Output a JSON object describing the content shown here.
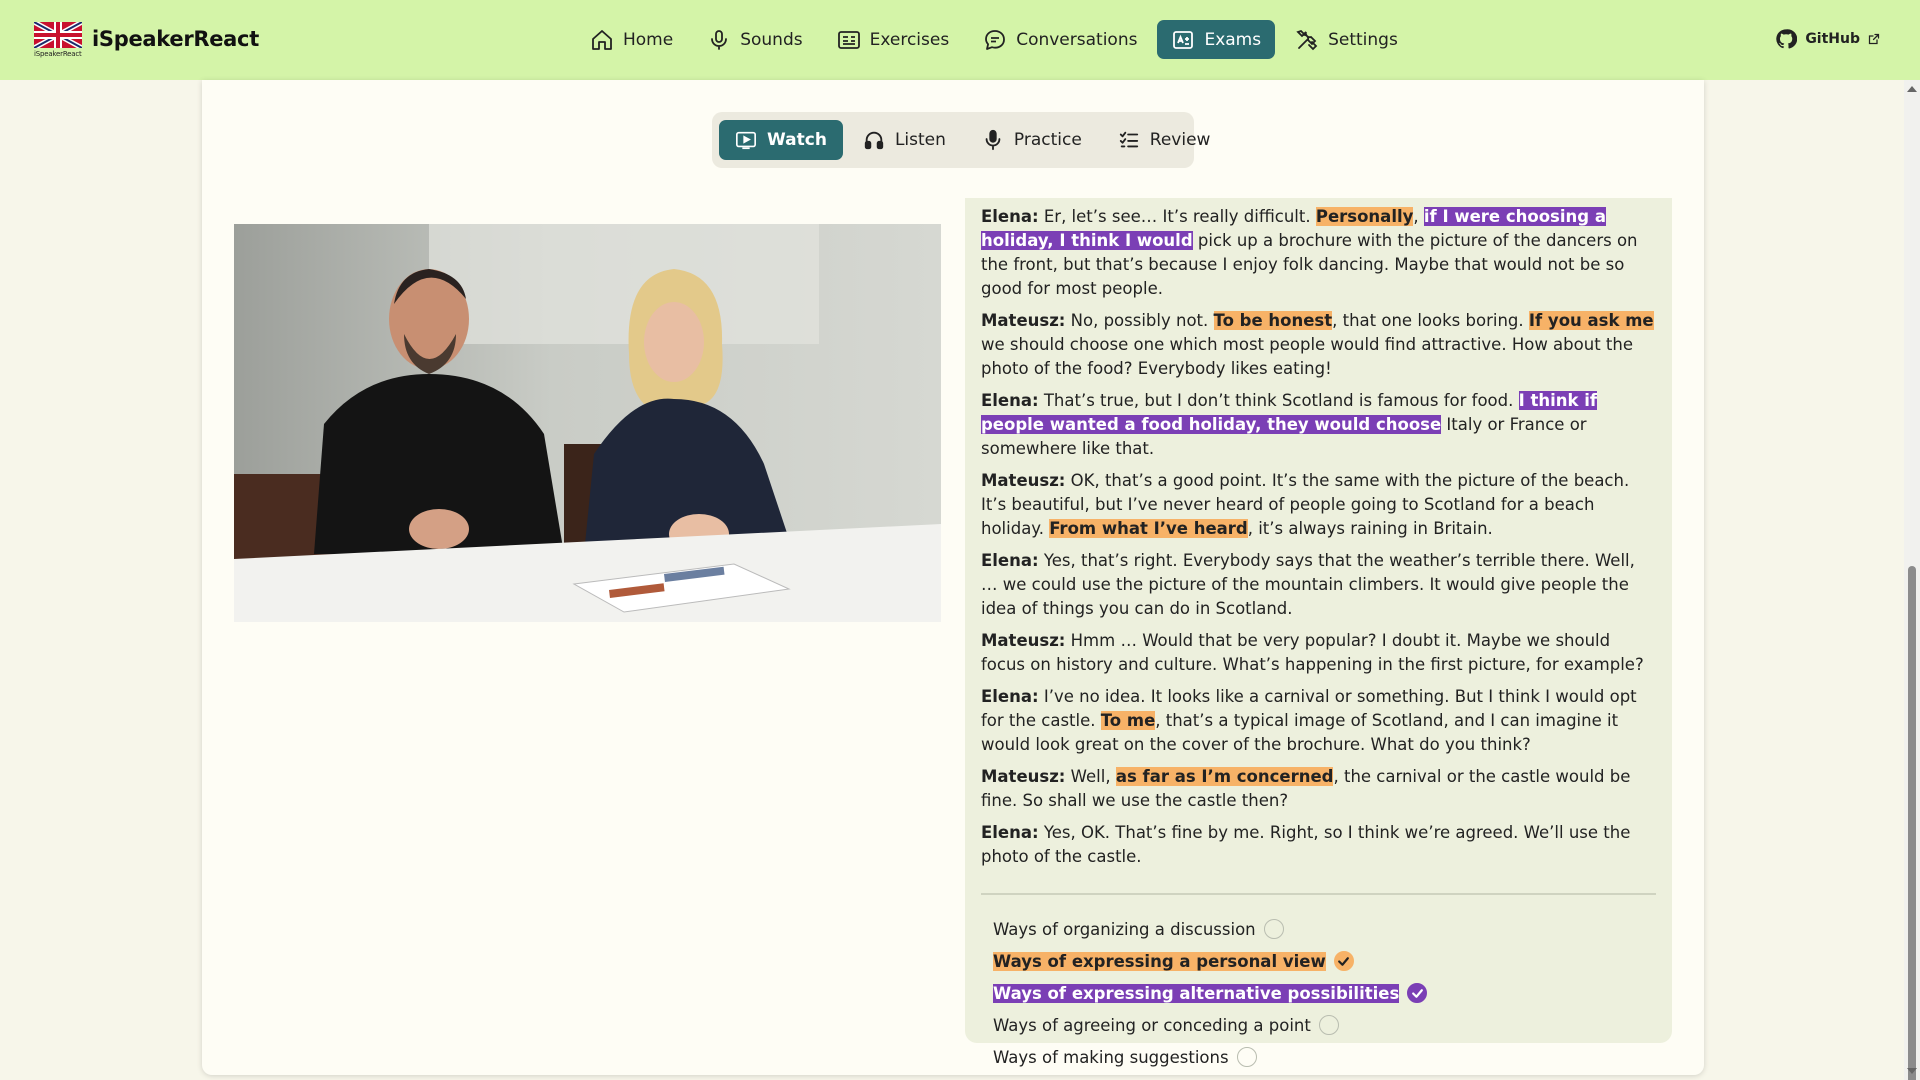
{
  "brand": {
    "name": "iSpeakerReact",
    "logo_text": "iSpeakerReact"
  },
  "nav": {
    "items": [
      {
        "label": "Home",
        "icon": "home-icon"
      },
      {
        "label": "Sounds",
        "icon": "microphone-icon"
      },
      {
        "label": "Exercises",
        "icon": "exercises-icon"
      },
      {
        "label": "Conversations",
        "icon": "chat-bubble-icon"
      },
      {
        "label": "Exams",
        "icon": "exam-icon",
        "active": true
      },
      {
        "label": "Settings",
        "icon": "settings-icon"
      }
    ],
    "github_label": "GitHub"
  },
  "subtabs": [
    {
      "label": "Watch",
      "icon": "video-icon",
      "active": true
    },
    {
      "label": "Listen",
      "icon": "headphones-icon"
    },
    {
      "label": "Practice",
      "icon": "microphone-icon"
    },
    {
      "label": "Review",
      "icon": "checklist-icon"
    }
  ],
  "transcript": [
    {
      "speaker": "Elena:",
      "parts": [
        {
          "t": " Er, let’s see… It’s really difficult. "
        },
        {
          "t": "Personally",
          "h": "o"
        },
        {
          "t": ", "
        },
        {
          "t": "if I were choosing a holiday, I think I would",
          "h": "p"
        },
        {
          "t": " pick up a brochure with the picture of the dancers on the front, but that’s because I enjoy folk dancing. Maybe that would not be so good for most people."
        }
      ]
    },
    {
      "speaker": "Mateusz:",
      "parts": [
        {
          "t": " No, possibly not. "
        },
        {
          "t": "To be honest",
          "h": "o"
        },
        {
          "t": ", that one looks boring. "
        },
        {
          "t": "If you ask me",
          "h": "o"
        },
        {
          "t": " we should choose one which most people would find attractive. How about the photo of the food? Everybody likes eating!"
        }
      ]
    },
    {
      "speaker": "Elena:",
      "parts": [
        {
          "t": " That’s true, but I don’t think Scotland is famous for food. "
        },
        {
          "t": "I think if people wanted a food holiday, they would choose",
          "h": "p"
        },
        {
          "t": " Italy or France or somewhere like that."
        }
      ]
    },
    {
      "speaker": "Mateusz:",
      "parts": [
        {
          "t": " OK, that’s a good point. It’s the same with the picture of the beach. It’s beautiful, but I’ve never heard of people going to Scotland for a beach holiday. "
        },
        {
          "t": "From what I’ve heard",
          "h": "o"
        },
        {
          "t": ", it’s always raining in Britain."
        }
      ]
    },
    {
      "speaker": "Elena:",
      "parts": [
        {
          "t": " Yes, that’s right. Everybody says that the weather’s terrible there. Well, … we could use the picture of the mountain climbers. It would give people the idea of things you can do in Scotland."
        }
      ]
    },
    {
      "speaker": "Mateusz:",
      "parts": [
        {
          "t": " Hmm … Would that be very popular? I doubt it. Maybe we should focus on history and culture. What’s happening in the first picture, for example?"
        }
      ]
    },
    {
      "speaker": "Elena:",
      "parts": [
        {
          "t": " I’ve no idea. It looks like a carnival or something. But I think I would opt for the castle. "
        },
        {
          "t": "To me",
          "h": "o"
        },
        {
          "t": ", that’s a typical image of Scotland, and I can imagine it would look great on the cover of the brochure. What do you think?"
        }
      ]
    },
    {
      "speaker": "Mateusz:",
      "parts": [
        {
          "t": " Well, "
        },
        {
          "t": "as far as I’m concerned",
          "h": "o"
        },
        {
          "t": ", the carnival or the castle would be fine. So shall we use the castle then?"
        }
      ]
    },
    {
      "speaker": "Elena:",
      "parts": [
        {
          "t": " Yes, OK. That’s fine by me. Right, so I think we’re agreed. We’ll use the photo of the castle."
        }
      ]
    }
  ],
  "legend": [
    {
      "label": "Ways of organizing a discussion",
      "checked": false
    },
    {
      "label": "Ways of expressing a personal view",
      "checked": true,
      "h": "o"
    },
    {
      "label": "Ways of expressing alternative possibilities",
      "checked": true,
      "h": "p"
    },
    {
      "label": "Ways of agreeing or conceding a point",
      "checked": false
    },
    {
      "label": "Ways of making suggestions",
      "checked": false
    }
  ],
  "colors": {
    "navbar": "#d4f4a8",
    "accent": "#2b6b70",
    "highlight_orange": "#f7b267",
    "highlight_purple": "#7b3fb5"
  }
}
